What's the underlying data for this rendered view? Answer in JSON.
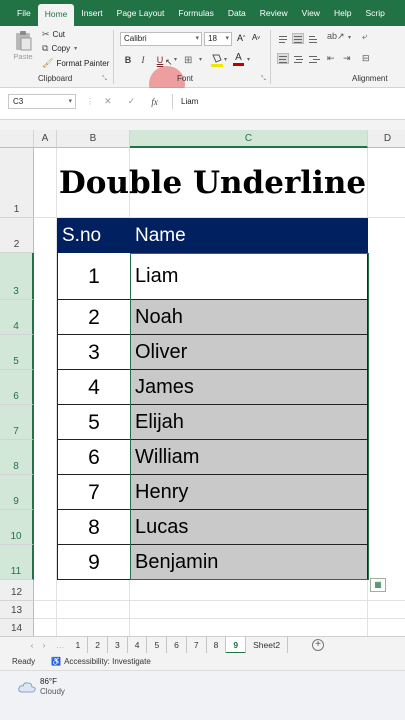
{
  "ribbon_tabs": [
    "File",
    "Home",
    "Insert",
    "Page Layout",
    "Formulas",
    "Data",
    "Review",
    "View",
    "Help",
    "Scrip"
  ],
  "active_tab": "Home",
  "clipboard": {
    "paste": "Paste",
    "cut": "Cut",
    "copy": "Copy",
    "format_painter": "Format Painter",
    "label": "Clipboard"
  },
  "font": {
    "name": "Calibri",
    "size": "18",
    "bold": "B",
    "italic": "I",
    "underline": "U",
    "label": "Font"
  },
  "alignment": {
    "label": "Alignment"
  },
  "formula_bar": {
    "name_box": "C3",
    "cancel": "✕",
    "enter": "✓",
    "fx": "fx",
    "value": "Liam"
  },
  "columns": [
    "A",
    "B",
    "C",
    "D"
  ],
  "rows": [
    "1",
    "2",
    "3",
    "4",
    "5",
    "6",
    "7",
    "8",
    "9",
    "10",
    "11",
    "12",
    "13",
    "14"
  ],
  "sheet": {
    "title": "Double Underline",
    "headers": {
      "sno": "S.no",
      "name": "Name"
    },
    "records": [
      {
        "sno": "1",
        "name": "Liam"
      },
      {
        "sno": "2",
        "name": "Noah"
      },
      {
        "sno": "3",
        "name": "Oliver"
      },
      {
        "sno": "4",
        "name": "James"
      },
      {
        "sno": "5",
        "name": "Elijah"
      },
      {
        "sno": "6",
        "name": "William"
      },
      {
        "sno": "7",
        "name": "Henry"
      },
      {
        "sno": "8",
        "name": "Lucas"
      },
      {
        "sno": "9",
        "name": "Benjamin"
      }
    ]
  },
  "sheet_tabs": [
    "1",
    "2",
    "3",
    "4",
    "5",
    "6",
    "7",
    "8",
    "9",
    "Sheet2"
  ],
  "active_sheet": "9",
  "status": {
    "ready": "Ready",
    "accessibility": "Accessibility: Investigate"
  },
  "weather": {
    "temp": "86°F",
    "desc": "Cloudy"
  },
  "colors": {
    "excel_green": "#217346",
    "header_fill": "#002060",
    "name_fill": "#c9c9c9"
  }
}
